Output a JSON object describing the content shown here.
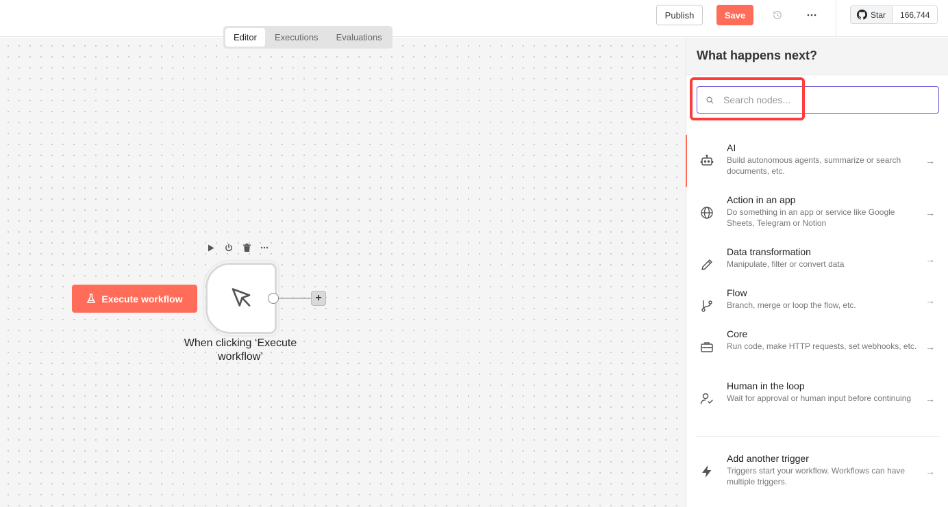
{
  "header": {
    "publish_label": "Publish",
    "save_label": "Save",
    "github_star_label": "Star",
    "github_star_count": "166,744"
  },
  "canvas": {
    "tabs": [
      {
        "label": "Editor",
        "active": true
      },
      {
        "label": "Executions",
        "active": false
      },
      {
        "label": "Evaluations",
        "active": false
      }
    ],
    "execute_button_label": "Execute workflow",
    "trigger_node_label": "When clicking ‘Execute workflow’",
    "add_node_label": "+"
  },
  "panel": {
    "title": "What happens next?",
    "search_placeholder": "Search nodes...",
    "items": [
      {
        "icon": "robot-icon",
        "title": "AI",
        "description": "Build autonomous agents, summarize or search documents, etc."
      },
      {
        "icon": "globe-icon",
        "title": "Action in an app",
        "description": "Do something in an app or service like Google Sheets, Telegram or Notion"
      },
      {
        "icon": "pen-icon",
        "title": "Data transformation",
        "description": "Manipulate, filter or convert data"
      },
      {
        "icon": "branch-icon",
        "title": "Flow",
        "description": "Branch, merge or loop the flow, etc."
      },
      {
        "icon": "toolbox-icon",
        "title": "Core",
        "description": "Run code, make HTTP requests, set webhooks, etc."
      },
      {
        "icon": "user-check-icon",
        "title": "Human in the loop",
        "description": "Wait for approval or human input before continuing"
      }
    ],
    "trigger": {
      "icon": "bolt-icon",
      "title": "Add another trigger",
      "description": "Triggers start your workflow. Workflows can have multiple triggers."
    }
  },
  "colors": {
    "accent": "#ff6d5a",
    "search_border": "#6b5bd6",
    "highlight": "#ff3b3b"
  }
}
